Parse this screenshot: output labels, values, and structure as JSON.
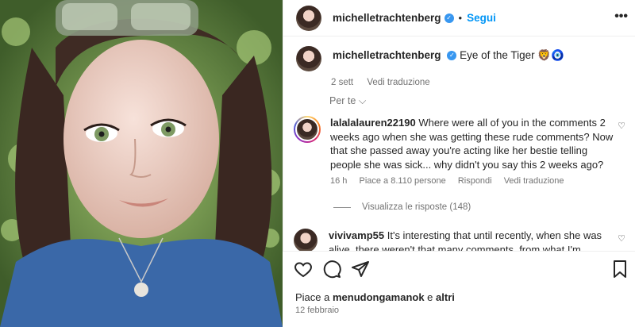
{
  "post": {
    "author": "michelletrachtenberg",
    "follow_label": "Segui",
    "more_label": "•••",
    "caption": {
      "username": "michelletrachtenberg",
      "text": "Eye of the Tiger 🦁🧿",
      "time": "2 sett",
      "translate": "Vedi traduzione"
    },
    "sort_label": "Per te ⌵",
    "comments": [
      {
        "username": "lalalalauren22190",
        "text": "Where were all of you in the comments 2 weeks ago when she was getting these rude comments? Now that she passed away you're acting like her bestie telling people she was sick... why didn't you say this 2 weeks ago?",
        "time": "16 h",
        "likes": "Piace a 8.110 persone",
        "reply": "Rispondi",
        "translate": "Vedi traduzione",
        "view_replies": "Visualizza le risposte (148)"
      },
      {
        "username": "vivivamp55",
        "text": "It's interesting that until recently, when she was alive, there weren't that many comments, from what I'm"
      }
    ],
    "likes_prefix": "Piace a ",
    "likes_user": "menudongamanok",
    "likes_join": " e ",
    "likes_others": "altri",
    "date": "12 febbraio"
  }
}
